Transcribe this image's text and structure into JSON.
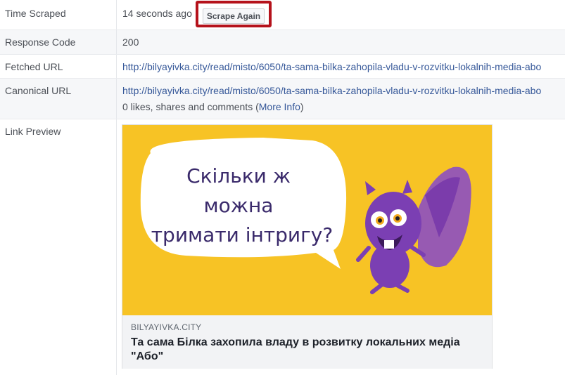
{
  "rows": {
    "time_scraped": {
      "label": "Time Scraped",
      "value": "14 seconds ago",
      "button": "Scrape Again"
    },
    "response_code": {
      "label": "Response Code",
      "value": "200"
    },
    "fetched_url": {
      "label": "Fetched URL",
      "value": "http://bilyayivka.city/read/misto/6050/ta-sama-bilka-zahopila-vladu-v-rozvitku-lokalnih-media-abo"
    },
    "canonical_url": {
      "label": "Canonical URL",
      "value": "http://bilyayivka.city/read/misto/6050/ta-sama-bilka-zahopila-vladu-v-rozvitku-lokalnih-media-abo",
      "stats_text": "0 likes, shares and comments (",
      "more_info": "More Info",
      "close_paren": ")"
    },
    "link_preview": {
      "label": "Link Preview"
    }
  },
  "preview": {
    "bubble_lines": [
      "Скільки ж",
      "можна",
      "тримати інтригу?"
    ],
    "domain": "BILYAYIVKA.CITY",
    "title": "Та сама Білка захопила владу в розвитку локальних медіа \"Або\""
  },
  "colors": {
    "highlight_border": "#b5121b",
    "link": "#365899",
    "preview_bg": "#f7c325",
    "squirrel": "#7b3fb3"
  }
}
